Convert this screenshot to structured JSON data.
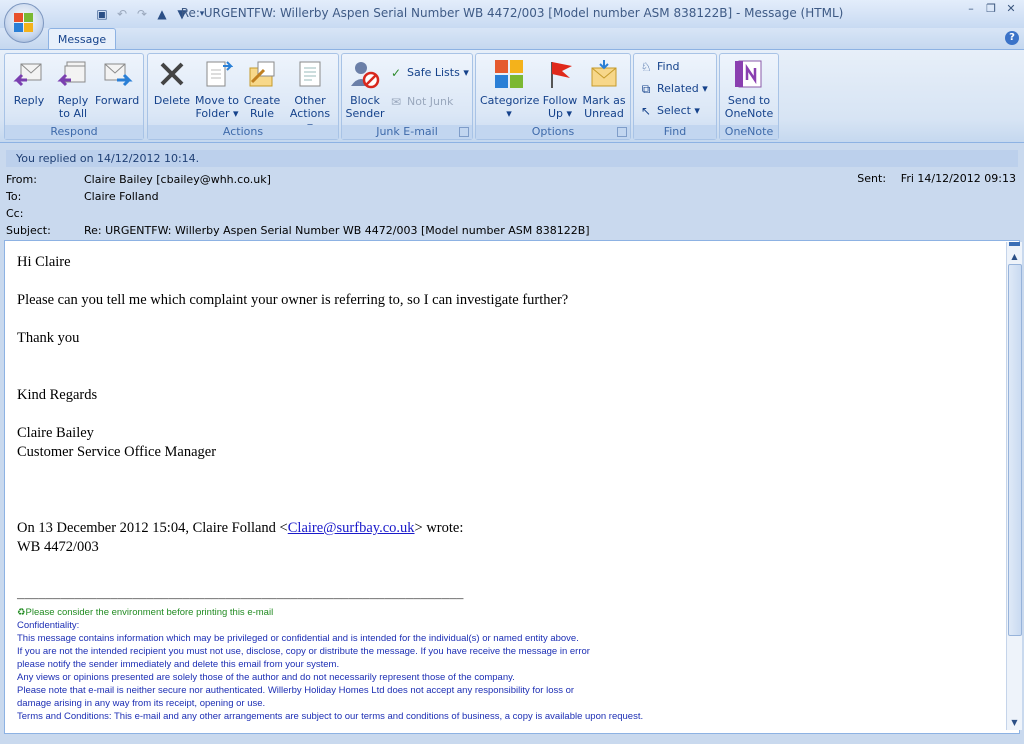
{
  "window": {
    "title": "Re: URGENTFW: Willerby Aspen Serial Number WB 4472/003 [Model number ASM 838122B] - Message (HTML)"
  },
  "tabs": [
    {
      "label": "Message"
    }
  ],
  "ribbon": {
    "respond": {
      "label": "Respond",
      "reply": "Reply",
      "reply_all_1": "Reply",
      "reply_all_2": "to All",
      "forward": "Forward"
    },
    "actions": {
      "label": "Actions",
      "delete": "Delete",
      "move_1": "Move to",
      "move_2": "Folder ▾",
      "create_1": "Create",
      "create_2": "Rule",
      "other_1": "Other",
      "other_2": "Actions ▾"
    },
    "junk": {
      "label": "Junk E-mail",
      "block_1": "Block",
      "block_2": "Sender",
      "safe_lists": "Safe Lists ▾",
      "not_junk": "Not Junk"
    },
    "options": {
      "label": "Options",
      "categorize_1": "Categorize",
      "categorize_2": "▾",
      "follow_1": "Follow",
      "follow_2": "Up ▾",
      "mark_1": "Mark as",
      "mark_2": "Unread"
    },
    "find": {
      "label": "Find",
      "find": "Find",
      "related": "Related ▾",
      "select": "Select ▾"
    },
    "onenote": {
      "label": "OneNote",
      "send_1": "Send to",
      "send_2": "OneNote"
    }
  },
  "infobar": "You replied on 14/12/2012 10:14.",
  "header": {
    "from_label": "From:",
    "from": "Claire Bailey [cbailey@whh.co.uk]",
    "to_label": "To:",
    "to": "Claire Folland",
    "cc_label": "Cc:",
    "cc": "",
    "subject_label": "Subject:",
    "subject": "Re: URGENTFW: Willerby Aspen Serial Number WB 4472/003 [Model number ASM 838122B]",
    "sent_label": "Sent:",
    "sent": "Fri 14/12/2012 09:13"
  },
  "body": {
    "greeting": "Hi Claire",
    "line1": "Please can you tell me which complaint your owner is referring to, so I can investigate further?",
    "thanks": "Thank you",
    "regards": "Kind Regards",
    "name": "Claire Bailey",
    "role": "Customer Service Office Manager",
    "quote_prefix": "On 13 December 2012 15:04, Claire Folland <",
    "quote_email": "Claire@surfbay.co.uk",
    "quote_suffix": "> wrote:",
    "quote_line": "WB 4472/003",
    "rule": "______________________________________________________________",
    "env": "Please consider the environment before printing this e-mail",
    "disc_title": "Confidentiality:",
    "disc": [
      "This message contains information which may be privileged or confidential and is intended for the individual(s) or named entity above.",
      "If you are not the intended recipient you must not use, disclose, copy or distribute the message. If you have receive the message in error",
      "please notify the sender immediately and delete this email from your system.",
      "Any views or opinions presented are solely those of the author and do not necessarily represent those of the company.",
      "Please note that e-mail is neither secure nor authenticated. Willerby Holiday Homes Ltd does not accept any responsibility for loss or",
      "damage arising in any way from its receipt, opening or use.",
      "Terms and Conditions: This e-mail and any other arrangements are subject to our terms and conditions of business, a copy is available upon request."
    ]
  }
}
